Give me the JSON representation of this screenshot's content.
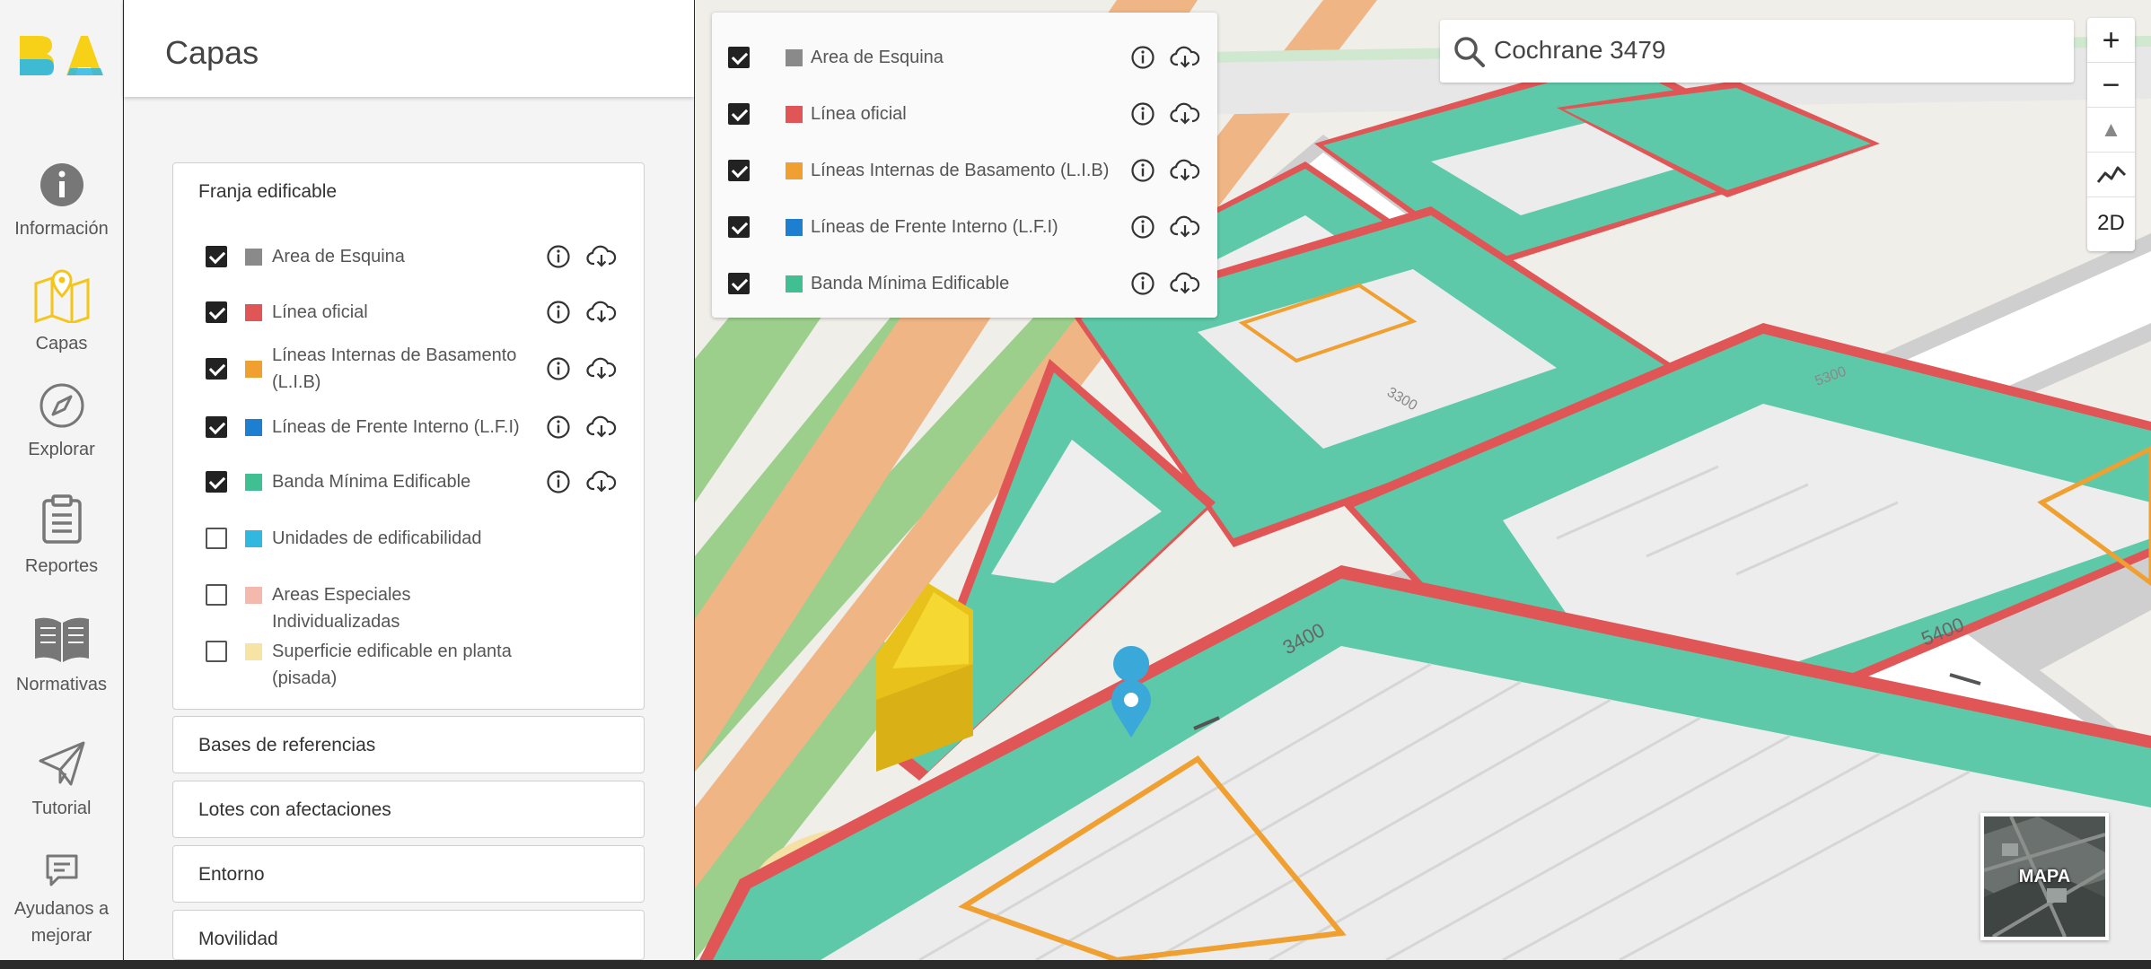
{
  "rail": {
    "items": [
      {
        "label": "Información",
        "icon": "info-circle-icon"
      },
      {
        "label": "Capas",
        "icon": "map-pin-icon"
      },
      {
        "label": "Explorar",
        "icon": "compass-icon"
      },
      {
        "label": "Reportes",
        "icon": "clipboard-icon"
      },
      {
        "label": "Normativas",
        "icon": "book-icon"
      },
      {
        "label": "Tutorial",
        "icon": "paper-plane-icon"
      },
      {
        "label": "Ayudanos a mejorar",
        "icon": "chat-icon"
      }
    ],
    "active": "Capas"
  },
  "panel": {
    "title": "Capas",
    "franja": {
      "title": "Franja edificable",
      "layers": [
        {
          "label": "Area de Esquina",
          "checked": true,
          "color": "#8a8a8a",
          "actions": true
        },
        {
          "label": "Línea oficial",
          "checked": true,
          "color": "#e05555",
          "actions": true
        },
        {
          "label": "Líneas Internas de Basamento (L.I.B)",
          "checked": true,
          "color": "#f0a030",
          "actions": true
        },
        {
          "label": "Líneas de Frente Interno (L.F.I)",
          "checked": true,
          "color": "#1e7fd0",
          "actions": true
        },
        {
          "label": "Banda Mínima Edificable",
          "checked": true,
          "color": "#3fbf92",
          "actions": true
        },
        {
          "label": "Unidades de edificabilidad",
          "checked": false,
          "color": "#30b8e0",
          "actions": false
        },
        {
          "label": "Areas Especiales Individualizadas",
          "checked": false,
          "color": "#f4b8ad",
          "actions": false
        },
        {
          "label": "Superficie edificable en planta (pisada)",
          "checked": false,
          "color": "#f7e4a2",
          "actions": false
        }
      ]
    },
    "sections": [
      "Bases de referencias",
      "Lotes con afectaciones",
      "Entorno",
      "Movilidad"
    ]
  },
  "legend": {
    "layers": [
      {
        "label": "Area de Esquina",
        "color": "#8a8a8a"
      },
      {
        "label": "Línea oficial",
        "color": "#e05555"
      },
      {
        "label": "Líneas Internas de Basamento (L.I.B)",
        "color": "#f0a030"
      },
      {
        "label": "Líneas de Frente Interno (L.F.I)",
        "color": "#1e7fd0"
      },
      {
        "label": "Banda Mínima Edificable",
        "color": "#3fbf92"
      }
    ]
  },
  "search": {
    "value": "Cochrane 3479"
  },
  "map_controls": {
    "zoom_in": "+",
    "zoom_out": "−",
    "compass": "▲",
    "view_mode": "2D"
  },
  "minimap": {
    "label": "MAPA"
  },
  "map_labels": {
    "street_numbers": [
      "3400",
      "5400",
      "3300",
      "5300"
    ]
  }
}
